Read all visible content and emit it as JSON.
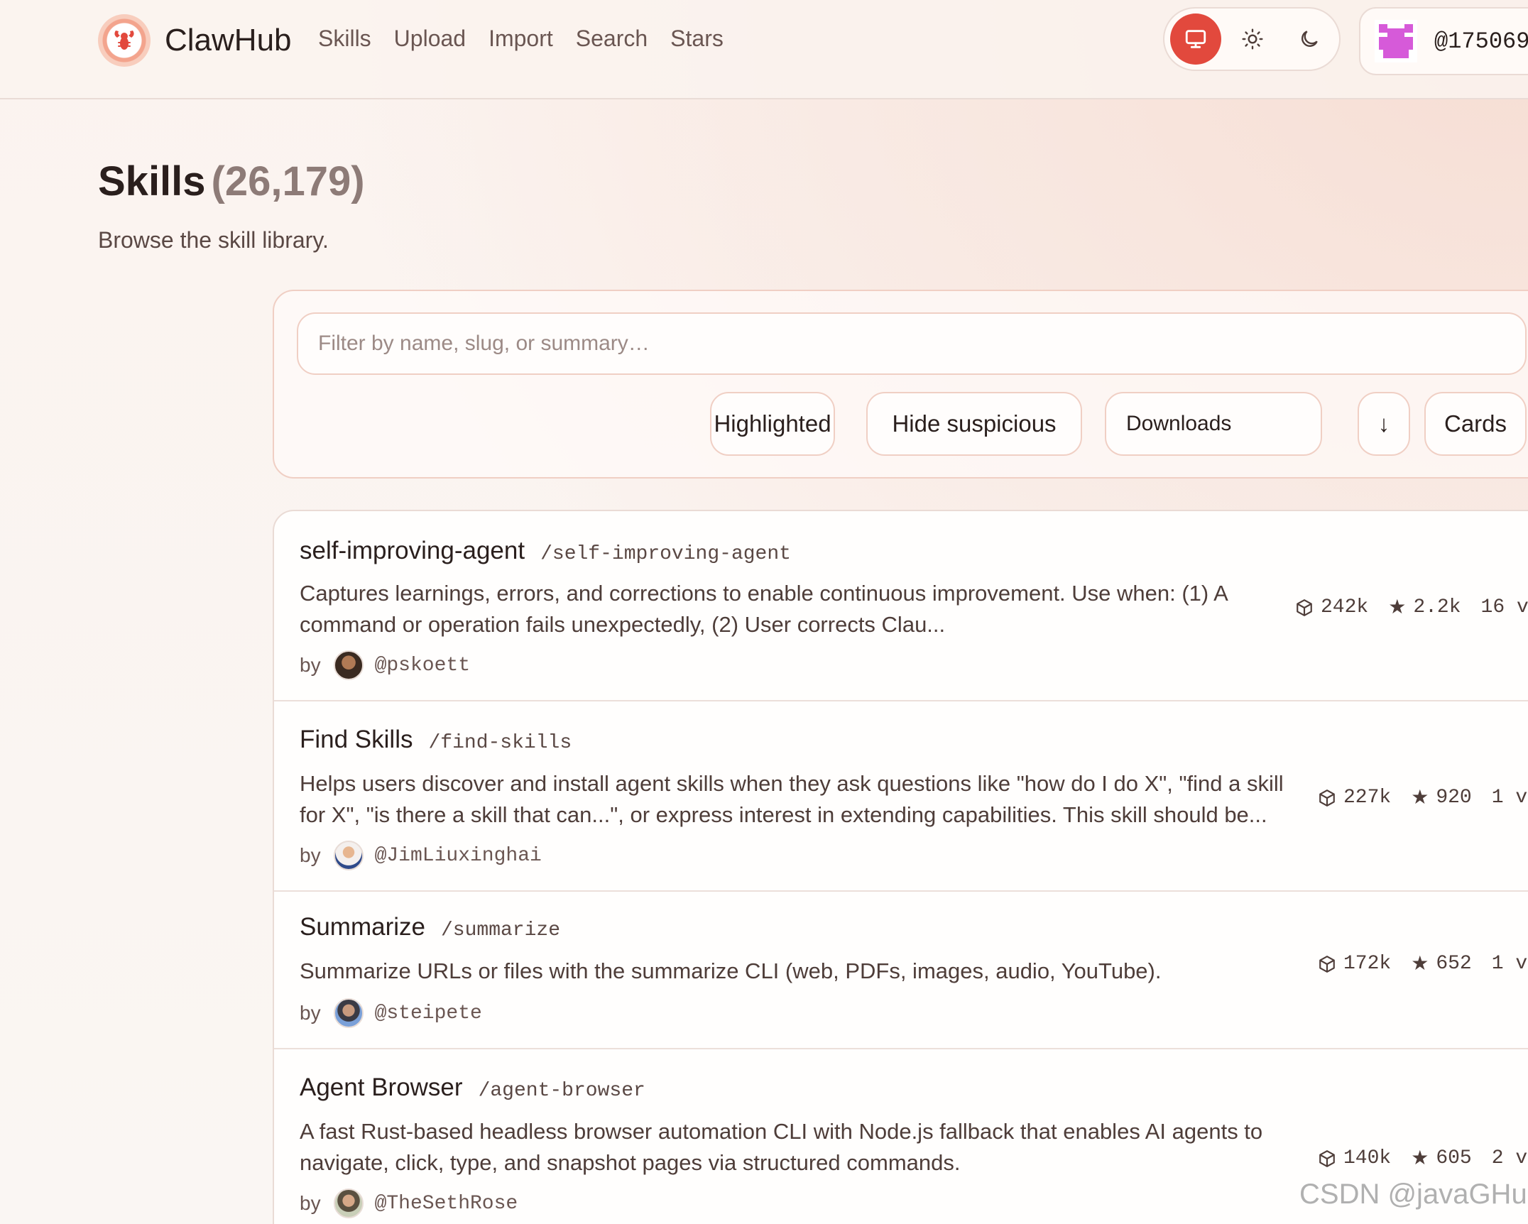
{
  "header": {
    "brand": "ClawHub",
    "nav": [
      "Skills",
      "Upload",
      "Import",
      "Search",
      "Stars"
    ],
    "theme_modes": [
      "system-icon",
      "sun-icon",
      "moon-icon"
    ],
    "active_theme": "system",
    "user_handle": "@175069"
  },
  "page": {
    "title": "Skills",
    "count": "(26,179)",
    "subtitle": "Browse the skill library."
  },
  "filters": {
    "search_placeholder": "Filter by name, slug, or summary…",
    "highlighted": "Highlighted",
    "hide_suspicious": "Hide suspicious",
    "sort": "Downloads",
    "sort_direction": "↓",
    "view": "Cards"
  },
  "skills": [
    {
      "name": "self-improving-agent",
      "slug": "/self-improving-agent",
      "summary": "Captures learnings, errors, and corrections to enable continuous improvement. Use when: (1) A command or operation fails unexpectedly, (2) User corrects Clau...",
      "by": "by",
      "author": "@pskoett",
      "downloads": "242k",
      "stars": "2.2k",
      "versions": "16 v"
    },
    {
      "name": "Find Skills",
      "slug": "/find-skills",
      "summary": "Helps users discover and install agent skills when they ask questions like \"how do I do X\", \"find a skill for X\", \"is there a skill that can...\", or express interest in extending capabilities. This skill should be...",
      "by": "by",
      "author": "@JimLiuxinghai",
      "downloads": "227k",
      "stars": "920",
      "versions": "1 v"
    },
    {
      "name": "Summarize",
      "slug": "/summarize",
      "summary": "Summarize URLs or files with the summarize CLI (web, PDFs, images, audio, YouTube).",
      "by": "by",
      "author": "@steipete",
      "downloads": "172k",
      "stars": "652",
      "versions": "1 v"
    },
    {
      "name": "Agent Browser",
      "slug": "/agent-browser",
      "summary": "A fast Rust-based headless browser automation CLI with Node.js fallback that enables AI agents to navigate, click, type, and snapshot pages via structured commands.",
      "by": "by",
      "author": "@TheSethRose",
      "downloads": "140k",
      "stars": "605",
      "versions": "2 v"
    }
  ],
  "watermark": "CSDN @javaGHui",
  "colors": {
    "accent": "#e2493d",
    "border": "#f0cfc4",
    "background": "#faf5f2"
  }
}
